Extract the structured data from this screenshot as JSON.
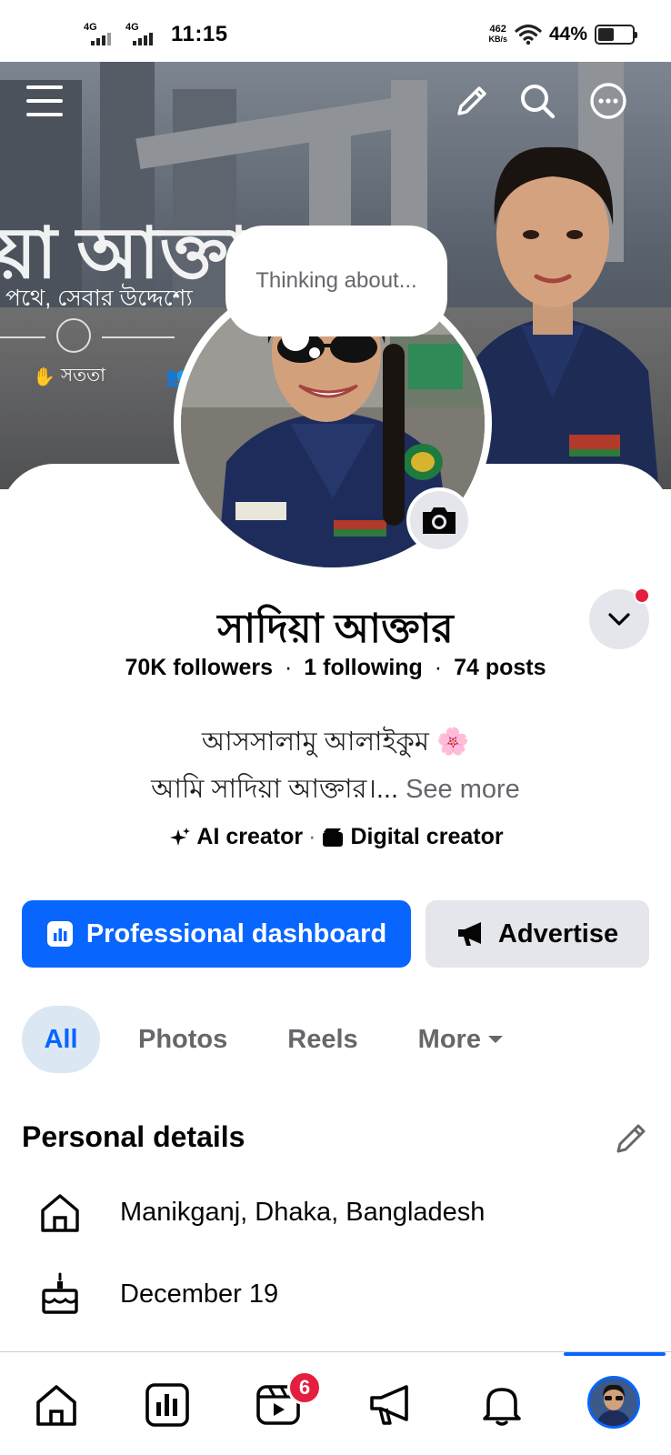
{
  "status_bar": {
    "net1": "4G",
    "net2": "4G",
    "time": "11:15",
    "speed_value": "462",
    "speed_unit": "KB/s",
    "battery_pct": "44%",
    "battery_level": 0.44
  },
  "cover": {
    "headline": "য়া আক্তার",
    "subline": "পথে, সেবার উদ্দেশ্যে",
    "tag": "সততা",
    "actions": [
      "menu-icon",
      "pencil-icon",
      "search-icon",
      "more-icon"
    ]
  },
  "thought_bubble": {
    "text": "Thinking about..."
  },
  "profile": {
    "name": "সাদিয়া আক্তার",
    "followers": "70K followers",
    "following": "1 following",
    "posts": "74 posts",
    "separator": "·",
    "bio_line1": "আসসালামু আলাইকুম 🌸",
    "bio_line2": "আমি সাদিয়া আক্তার।...",
    "see_more": "See more",
    "category1": "AI creator",
    "category_sep": "·",
    "category2": "Digital creator"
  },
  "buttons": {
    "dashboard": "Professional dashboard",
    "advertise": "Advertise"
  },
  "tabs": [
    {
      "label": "All",
      "active": true
    },
    {
      "label": "Photos",
      "active": false
    },
    {
      "label": "Reels",
      "active": false
    },
    {
      "label": "More",
      "active": false
    }
  ],
  "personal_details": {
    "title": "Personal details",
    "location": "Manikganj, Dhaka, Bangladesh",
    "birthday": "December 19"
  },
  "bottom_nav": {
    "items": [
      "home-icon",
      "dashboard-icon",
      "video-icon",
      "megaphone-icon",
      "bell-icon",
      "profile-avatar"
    ],
    "video_badge": "6"
  },
  "colors": {
    "accent": "#0866ff",
    "badge": "#e41e3f",
    "secondary_button": "#e4e6eb",
    "muted_text": "#65676b"
  }
}
